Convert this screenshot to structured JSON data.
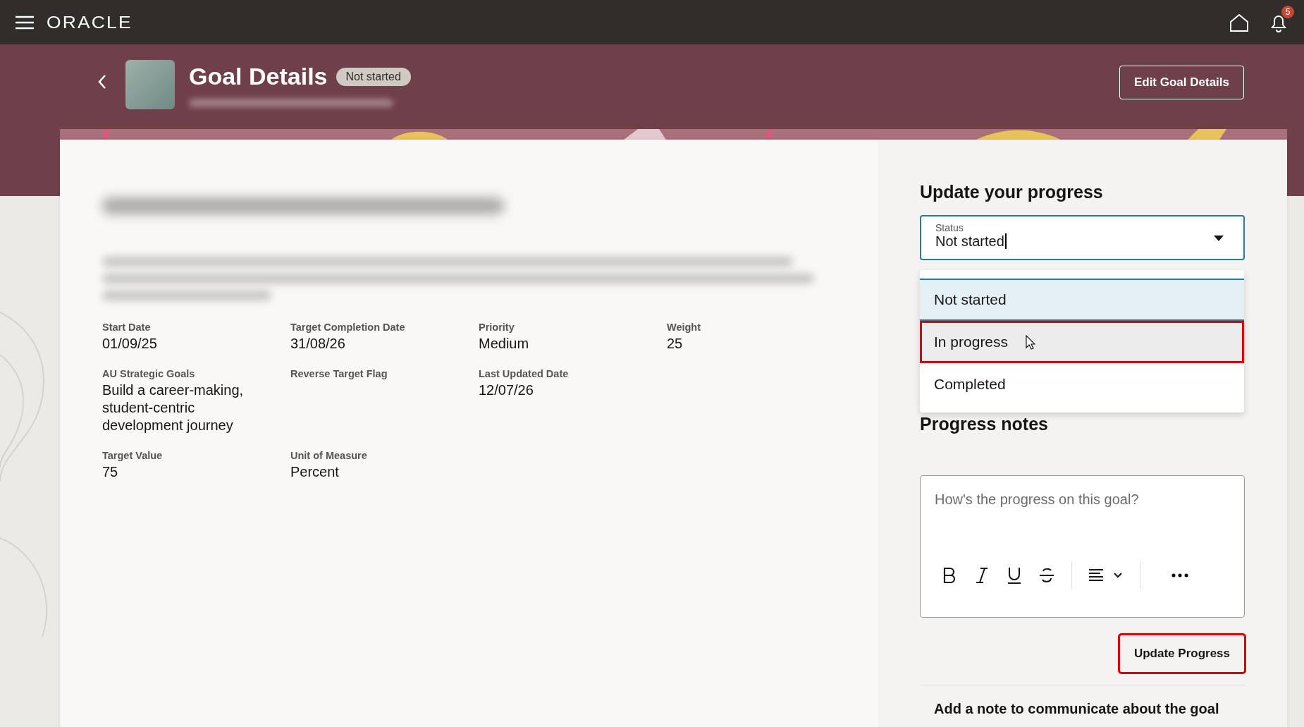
{
  "topbar": {
    "logo": "ORACLE",
    "notification_count": "5"
  },
  "header": {
    "title": "Goal Details",
    "status_badge": "Not started",
    "button": "Edit Goal Details"
  },
  "detail_rows": [
    [
      {
        "label": "Start Date",
        "value": "01/09/25"
      },
      {
        "label": "Target Completion Date",
        "value": "31/08/26"
      },
      {
        "label": "Priority",
        "value": "Medium"
      },
      {
        "label": "Weight",
        "value": "25"
      }
    ],
    [
      {
        "label": "AU Strategic Goals",
        "value": "Build a career-making, student-centric development journey"
      },
      {
        "label": "Reverse Target Flag"
      },
      {
        "label": "Last Updated Date",
        "value": "12/07/26"
      }
    ],
    [
      {
        "label": "Target Value",
        "value": "75"
      },
      {
        "label": "Unit of Measure",
        "value": "Percent"
      }
    ]
  ],
  "progress": {
    "heading": "Update your progress",
    "status_field": {
      "label": "Status",
      "value": "Not started",
      "expanded": true
    },
    "options": [
      {
        "label": "Not started",
        "selected": true,
        "hovered": false,
        "highlighted": false
      },
      {
        "label": "In progress",
        "selected": false,
        "hovered": true,
        "highlighted": true
      },
      {
        "label": "Completed",
        "selected": false,
        "hovered": false,
        "highlighted": false
      }
    ],
    "notes_heading": "Progress notes",
    "notes_placeholder": "How's the progress on this goal?",
    "button": {
      "label": "Update Progress",
      "highlighted": true
    },
    "note_heading": "Add a note to communicate about the goal"
  }
}
